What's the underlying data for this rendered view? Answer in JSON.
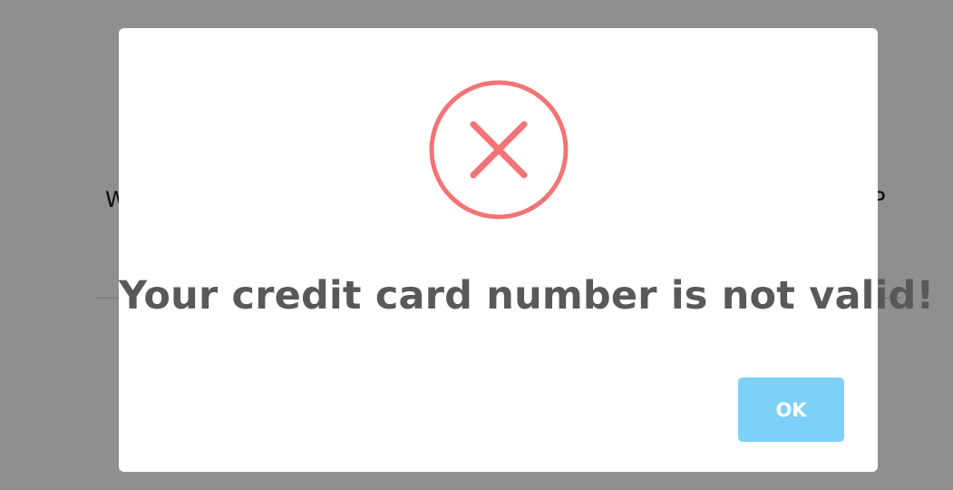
{
  "background": {
    "left_text": "W",
    "right_text": "P"
  },
  "dialog": {
    "icon": "error-x-circle-icon",
    "message": "Your credit card number is not valid!",
    "ok_label": "OK"
  },
  "colors": {
    "overlay": "#8e8f91",
    "icon_red": "#f27474",
    "message_text": "#595959",
    "ok_button_bg": "#7fd0f8",
    "ok_button_text": "#ffffff"
  }
}
